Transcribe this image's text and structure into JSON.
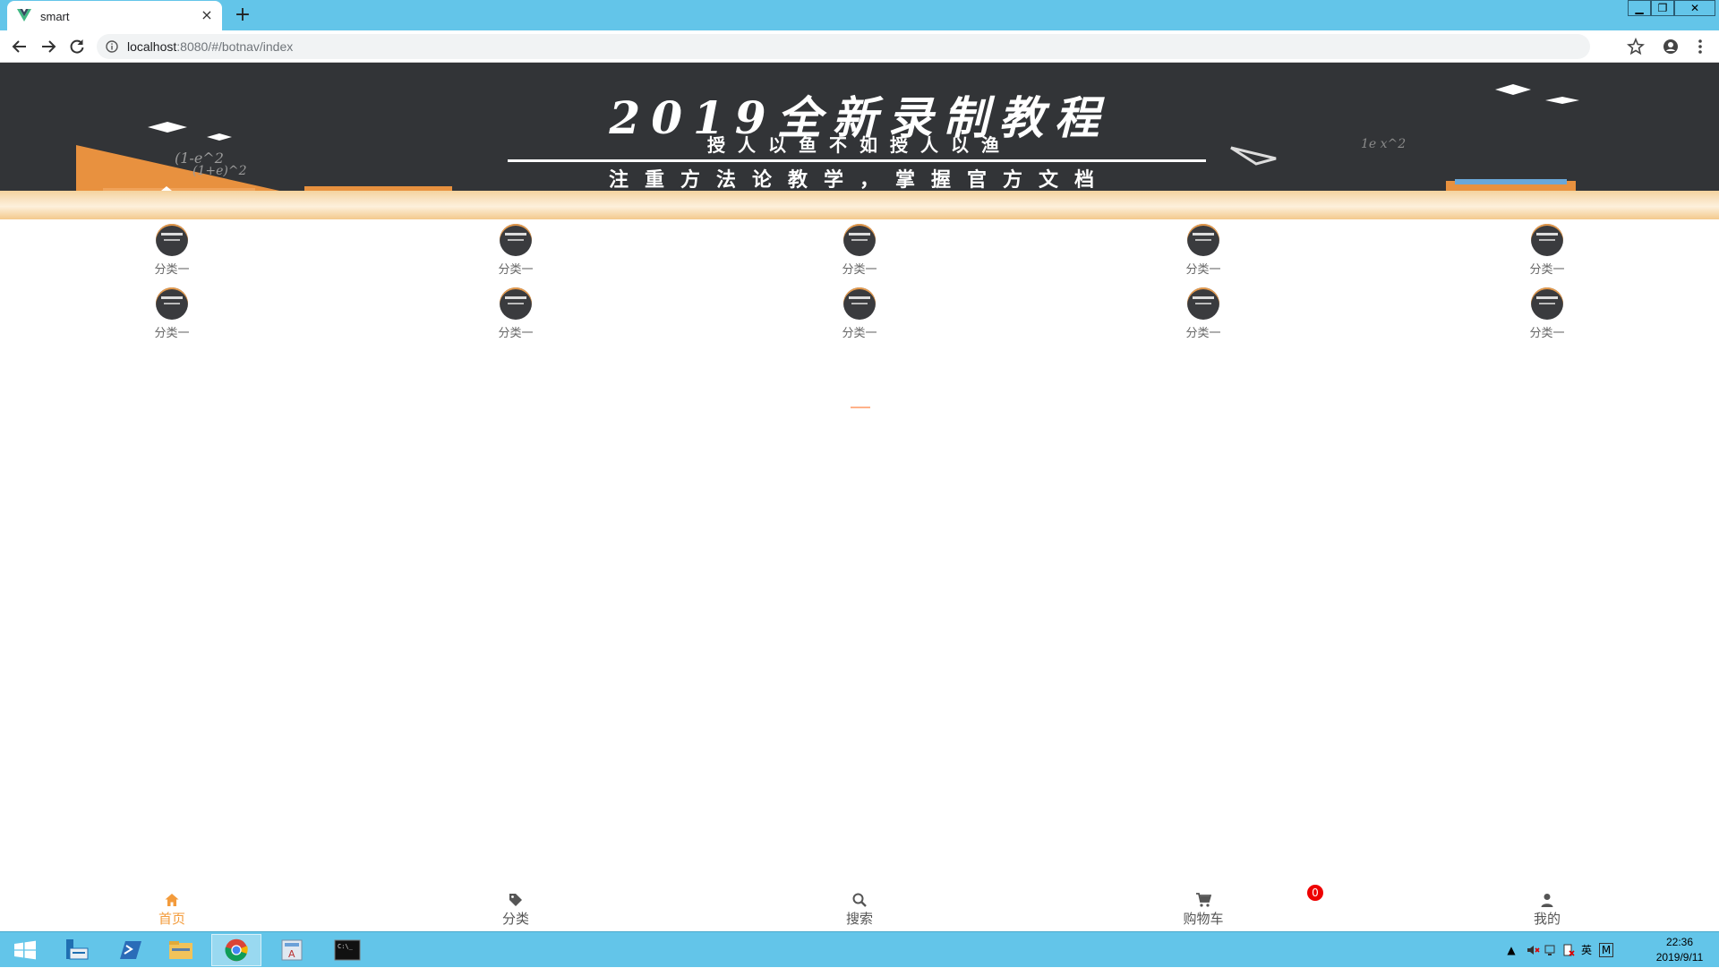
{
  "browser": {
    "tab_title": "smart",
    "new_tab_label": "+",
    "close_tab_label": "×",
    "url_host": "localhost",
    "url_rest": ":8080/#/botnav/index",
    "window_controls": {
      "minimize": "▁",
      "restore": "❐",
      "close": "✕"
    }
  },
  "banner": {
    "title": "2019全新录制教程",
    "subtitle1": "授人以鱼不如授人以渔",
    "subtitle2": "注重方法论教学，掌握官方文档"
  },
  "categories": [
    {
      "label": "分类一"
    },
    {
      "label": "分类一"
    },
    {
      "label": "分类一"
    },
    {
      "label": "分类一"
    },
    {
      "label": "分类一"
    },
    {
      "label": "分类一"
    },
    {
      "label": "分类一"
    },
    {
      "label": "分类一"
    },
    {
      "label": "分类一"
    },
    {
      "label": "分类一"
    }
  ],
  "bottom_nav": {
    "items": [
      {
        "label": "首页",
        "icon": "home-icon",
        "active": true
      },
      {
        "label": "分类",
        "icon": "tag-icon",
        "active": false
      },
      {
        "label": "搜索",
        "icon": "search-icon",
        "active": false
      },
      {
        "label": "购物车",
        "icon": "cart-icon",
        "active": false
      },
      {
        "label": "我的",
        "icon": "user-icon",
        "active": false
      }
    ],
    "cart_badge": "0",
    "active_color": "#f39b3b"
  },
  "taskbar": {
    "tray": {
      "ime": "英",
      "ime_mode": "M",
      "expand": "▲"
    },
    "clock_time": "22:36",
    "clock_date": "2019/9/11"
  },
  "colors": {
    "titlebar": "#63c5e9",
    "banner": "#323437",
    "accent": "#f39b3b",
    "badge": "#ee0000"
  }
}
